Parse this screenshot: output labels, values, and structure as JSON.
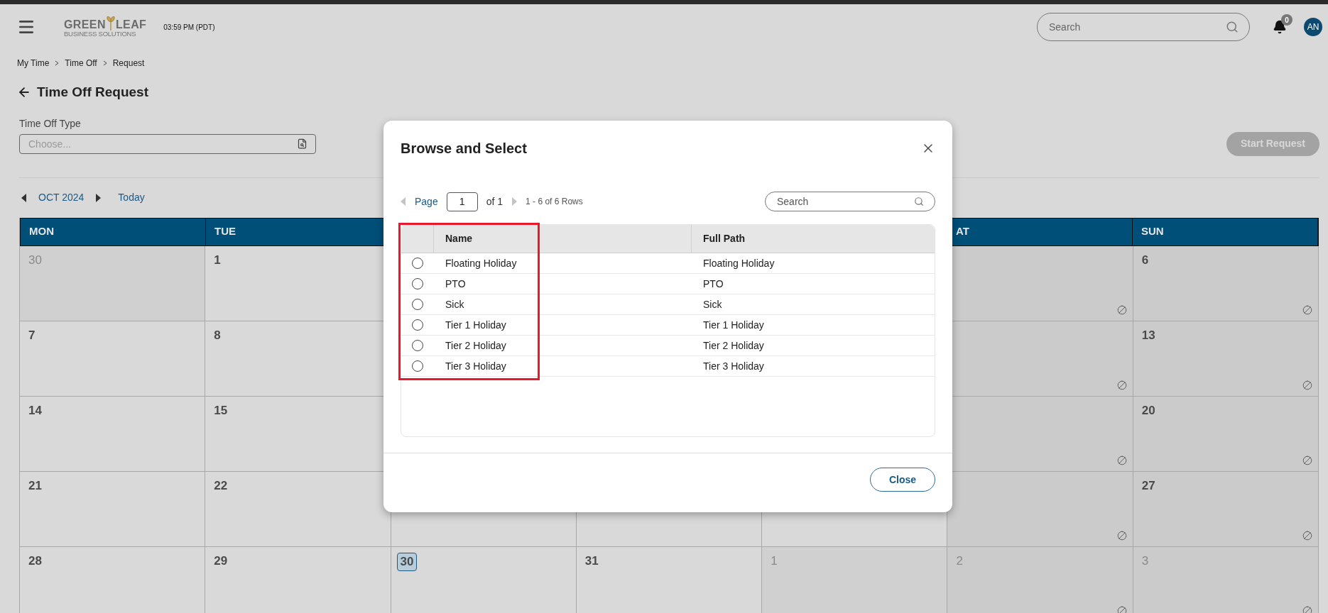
{
  "header": {
    "logo": {
      "name_left": "GREEN",
      "name_right": "LEAF",
      "tagline": "BUSINESS SOLUTIONS"
    },
    "time": "03:59 PM (PDT)",
    "search": {
      "placeholder": "Search"
    },
    "notifications": "0",
    "avatar": "AN"
  },
  "breadcrumb": [
    "My Time",
    "Time Off",
    "Request"
  ],
  "page_title": "Time Off Request",
  "time_off_type": {
    "label": "Time Off Type",
    "placeholder": "Choose..."
  },
  "start_button": {
    "label": "Start Request",
    "disabled": true
  },
  "calendar_nav": {
    "month": "OCT 2024",
    "today": "Today"
  },
  "calendar": {
    "headers": [
      {
        "kind": "mon",
        "label": "MON"
      },
      {
        "kind": "tue",
        "label": "TUE"
      },
      {
        "kind": "sat",
        "label": "AT"
      },
      {
        "kind": "sun",
        "label": "SUN"
      }
    ],
    "weeks": [
      [
        {
          "kind": "mon",
          "day": "30",
          "muted": true,
          "weekend": false,
          "today": false,
          "blocked": false
        },
        {
          "kind": "tue",
          "day": "1",
          "muted": false,
          "weekend": false,
          "today": false,
          "blocked": false
        },
        {
          "kind": "sat",
          "weekend": true,
          "blocked": true
        },
        {
          "kind": "sun",
          "day": "6",
          "muted": false,
          "weekend": true,
          "today": false,
          "blocked": true
        }
      ],
      [
        {
          "kind": "mon",
          "day": "7",
          "muted": false,
          "weekend": false,
          "today": false,
          "blocked": false
        },
        {
          "kind": "tue",
          "day": "8",
          "muted": false,
          "weekend": false,
          "today": false,
          "blocked": false
        },
        {
          "kind": "sat",
          "weekend": true,
          "blocked": true
        },
        {
          "kind": "sun",
          "day": "13",
          "muted": false,
          "weekend": true,
          "today": false,
          "blocked": true
        }
      ],
      [
        {
          "kind": "mon",
          "day": "14",
          "muted": false,
          "weekend": false,
          "today": false,
          "blocked": false
        },
        {
          "kind": "tue",
          "day": "15",
          "muted": false,
          "weekend": false,
          "today": false,
          "blocked": false
        },
        {
          "kind": "sat",
          "weekend": true,
          "blocked": true
        },
        {
          "kind": "sun",
          "day": "20",
          "muted": false,
          "weekend": true,
          "today": false,
          "blocked": true
        }
      ],
      [
        {
          "kind": "mon",
          "day": "21",
          "muted": false,
          "weekend": false,
          "today": false,
          "blocked": false
        },
        {
          "kind": "tue",
          "day": "22",
          "muted": false,
          "weekend": false,
          "today": false,
          "blocked": false
        },
        {
          "kind": "wed",
          "weekend": false,
          "blocked": false
        },
        {
          "kind": "thu",
          "weekend": false,
          "blocked": false
        },
        {
          "kind": "fri",
          "weekend": false,
          "blocked": false
        },
        {
          "kind": "sat",
          "weekend": true,
          "blocked": true
        },
        {
          "kind": "sun",
          "day": "27",
          "muted": false,
          "weekend": true,
          "today": false,
          "blocked": true
        }
      ],
      [
        {
          "kind": "mon",
          "day": "28",
          "muted": false,
          "weekend": false,
          "today": false,
          "blocked": false
        },
        {
          "kind": "tue",
          "day": "29",
          "muted": false,
          "weekend": false,
          "today": false,
          "blocked": false
        },
        {
          "kind": "wed",
          "day": "30",
          "muted": false,
          "weekend": false,
          "today": true,
          "blocked": false
        },
        {
          "kind": "thu",
          "day": "31",
          "muted": false,
          "weekend": false,
          "today": false,
          "blocked": false
        },
        {
          "kind": "fri",
          "day": "1",
          "muted": true,
          "weekend": false,
          "today": false,
          "blocked": false
        },
        {
          "kind": "sat",
          "day": "2",
          "muted": true,
          "weekend": true,
          "today": false,
          "blocked": true
        },
        {
          "kind": "sun",
          "day": "3",
          "muted": true,
          "weekend": true,
          "today": false,
          "blocked": true
        }
      ]
    ]
  },
  "dialog": {
    "title": "Browse and Select",
    "pager": {
      "label": "Page",
      "page": "1",
      "of": "of 1",
      "rows": "1 - 6 of 6 Rows"
    },
    "search": {
      "placeholder": "Search"
    },
    "table": {
      "columns": [
        "Name",
        "Full Path"
      ],
      "highlight_frame": true,
      "rows": [
        {
          "name": "Floating Holiday",
          "path": "Floating Holiday",
          "selected": false
        },
        {
          "name": "PTO",
          "path": "PTO",
          "selected": false
        },
        {
          "name": "Sick",
          "path": "Sick",
          "selected": false
        },
        {
          "name": "Tier 1 Holiday",
          "path": "Tier 1 Holiday",
          "selected": false
        },
        {
          "name": "Tier 2 Holiday",
          "path": "Tier 2 Holiday",
          "selected": false
        },
        {
          "name": "Tier 3 Holiday",
          "path": "Tier 3 Holiday",
          "selected": false
        }
      ]
    },
    "close_button": "Close"
  }
}
